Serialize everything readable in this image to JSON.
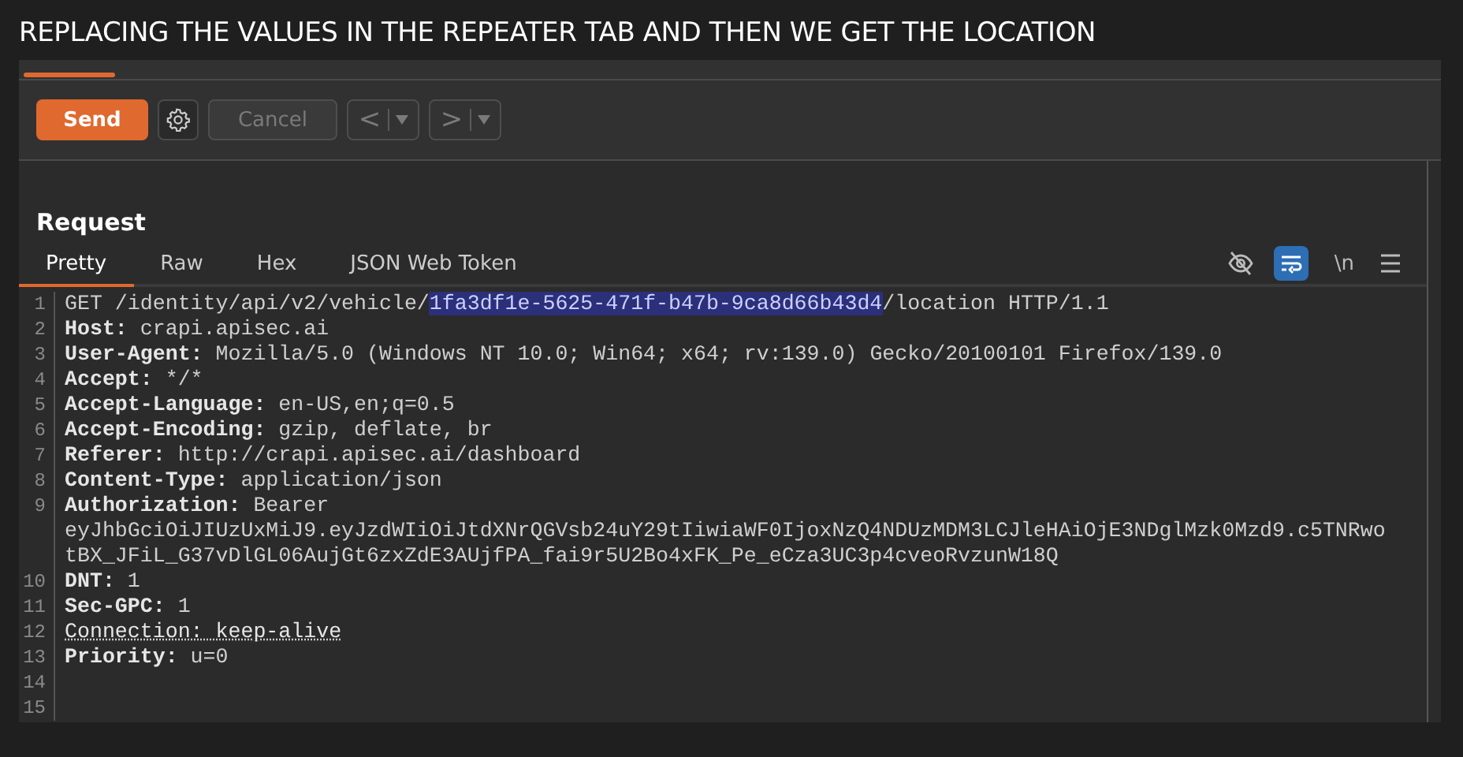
{
  "caption": "REPLACING THE VALUES IN THE REPEATER TAB AND THEN WE GET THE LOCATION",
  "toolbar": {
    "send": "Send",
    "cancel": {
      "label": "Cancel",
      "disabled": true
    },
    "nav_buttons": [
      {
        "label": "<",
        "disabled": true
      },
      {
        "label": ">",
        "disabled": true
      }
    ]
  },
  "request": {
    "title": "Request",
    "tabs": [
      {
        "label": "Pretty",
        "selected": true
      },
      {
        "label": "Raw",
        "selected": false
      },
      {
        "label": "Hex",
        "selected": false
      },
      {
        "label": "JSON Web Token",
        "selected": false
      }
    ],
    "tools": {
      "hide_on": false,
      "wrap_on": true,
      "newline": "\\n"
    },
    "lines": [
      {
        "number": "1",
        "segments": [
          {
            "text": "GET /identity/api/v2/vehicle/",
            "kind": "value"
          },
          {
            "text": "1fa3df1e-5625-471f-b47b-9ca8d66b43d4",
            "kind": "selected"
          },
          {
            "text": "/location HTTP/1.1",
            "kind": "value"
          }
        ]
      },
      {
        "number": "2",
        "segments": [
          {
            "text": "Host:",
            "kind": "key"
          },
          {
            "text": " crapi.apisec.ai",
            "kind": "value"
          }
        ]
      },
      {
        "number": "3",
        "segments": [
          {
            "text": "User-Agent:",
            "kind": "key"
          },
          {
            "text": " Mozilla/5.0 (Windows NT 10.0; Win64; x64; rv:139.0) Gecko/20100101 Firefox/139.0",
            "kind": "value"
          }
        ]
      },
      {
        "number": "4",
        "segments": [
          {
            "text": "Accept:",
            "kind": "key"
          },
          {
            "text": " */*",
            "kind": "value"
          }
        ]
      },
      {
        "number": "5",
        "segments": [
          {
            "text": "Accept-Language:",
            "kind": "key"
          },
          {
            "text": " en-US,en;q=0.5",
            "kind": "value"
          }
        ]
      },
      {
        "number": "6",
        "segments": [
          {
            "text": "Accept-Encoding:",
            "kind": "key"
          },
          {
            "text": " gzip, deflate, br",
            "kind": "value"
          }
        ]
      },
      {
        "number": "7",
        "segments": [
          {
            "text": "Referer:",
            "kind": "key"
          },
          {
            "text": " http://crapi.apisec.ai/dashboard",
            "kind": "value"
          }
        ]
      },
      {
        "number": "8",
        "segments": [
          {
            "text": "Content-Type:",
            "kind": "key"
          },
          {
            "text": " application/json",
            "kind": "value"
          }
        ]
      },
      {
        "number": "9",
        "segments": [
          {
            "text": "Authorization:",
            "kind": "key"
          },
          {
            "text": " Bearer",
            "kind": "value"
          }
        ],
        "continuation": [
          "eyJhbGciOiJIUzUxMiJ9.eyJzdWIiOiJtdXNrQGVsb24uY29tIiwiaWF0IjoxNzQ4NDUzMDM3LCJleHAiOjE3NDglMzk0Mzd9.c5TNRwo",
          "tBX_JFiL_G37vDlGL06AujGt6zxZdE3AUjfPA_fai9r5U2Bo4xFK_Pe_eCza3UC3p4cveoRvzunW18Q"
        ]
      },
      {
        "number": "10",
        "segments": [
          {
            "text": "DNT:",
            "kind": "key"
          },
          {
            "text": " 1",
            "kind": "value"
          }
        ]
      },
      {
        "number": "11",
        "segments": [
          {
            "text": "Sec-GPC:",
            "kind": "key"
          },
          {
            "text": " 1",
            "kind": "value"
          }
        ]
      },
      {
        "number": "12",
        "segments": [
          {
            "text": "Connection: keep-alive",
            "kind": "flagged"
          }
        ]
      },
      {
        "number": "13",
        "segments": [
          {
            "text": "Priority:",
            "kind": "key"
          },
          {
            "text": " u=0",
            "kind": "value"
          }
        ]
      },
      {
        "number": "14"
      },
      {
        "number": "15"
      }
    ]
  }
}
